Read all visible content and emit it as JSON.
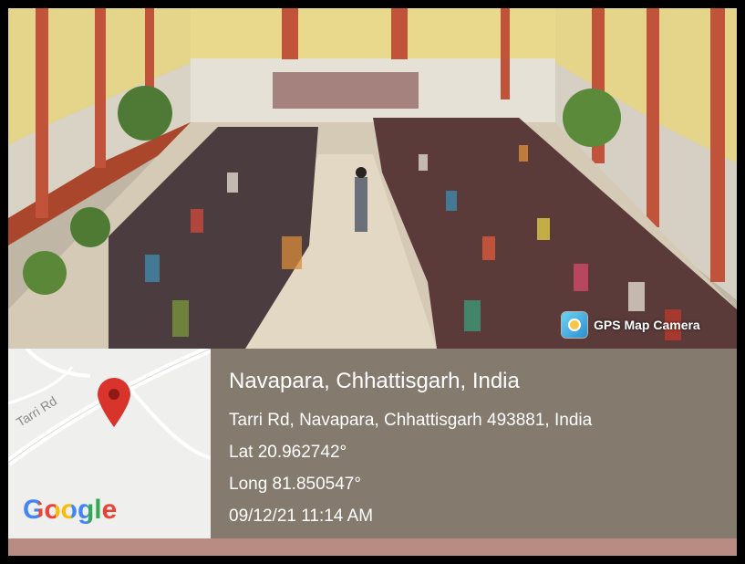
{
  "photo": {
    "subject": "school courtyard assembly photo"
  },
  "watermark": {
    "app_label": "GPS Map Camera",
    "icon": "camera-lens-icon"
  },
  "map": {
    "road_label": "Tarri Rd",
    "logo_text": "Google",
    "pin_color": "#d8342c"
  },
  "location": {
    "title": "Navapara, Chhattisgarh, India",
    "address": "Tarri Rd, Navapara, Chhattisgarh 493881, India",
    "lat": "Lat 20.962742°",
    "long": "Long 81.850547°",
    "datetime": "09/12/21 11:14 AM"
  }
}
